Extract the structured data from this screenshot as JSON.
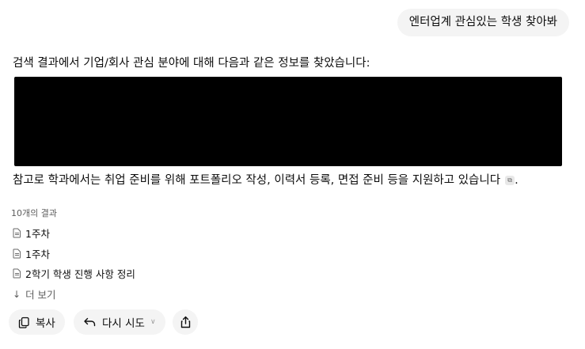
{
  "user_message": "엔터업계 관심있는 학생 찾아봐",
  "response": {
    "intro_text": "검색 결과에서 기업/회사 관심 분야에 대해 다음과 같은 정보를 찾았습니다:",
    "support_text": "참고로 학과에서는 취업 준비를 위해 포트폴리오 작성, 이력서 등록, 면접 준비 등을 지원하고 있습니다",
    "citation_glyph": "⧉",
    "trailing_period": "."
  },
  "sources": {
    "count_label": "10개의 결과",
    "items": [
      {
        "title": "1주차",
        "icon": "document-icon"
      },
      {
        "title": "1주차",
        "icon": "document-icon"
      },
      {
        "title": "2학기 학생 진행 사항 정리",
        "icon": "document-icon"
      }
    ],
    "more_label": "더 보기"
  },
  "actions": {
    "copy_label": "복사",
    "retry_label": "다시 시도",
    "share_icon": "share-icon"
  }
}
